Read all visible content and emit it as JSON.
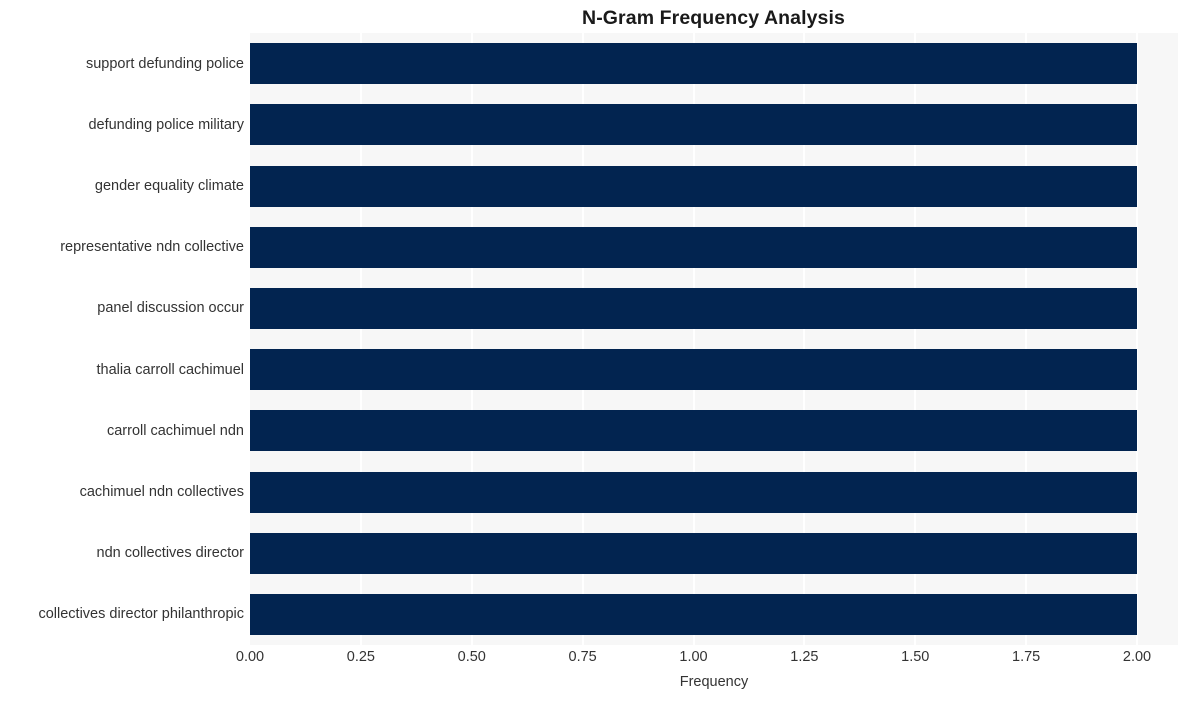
{
  "chart_data": {
    "type": "bar",
    "orientation": "horizontal",
    "title": "N-Gram Frequency Analysis",
    "xlabel": "Frequency",
    "ylabel": "",
    "categories": [
      "support defunding police",
      "defunding police military",
      "gender equality climate",
      "representative ndn collective",
      "panel discussion occur",
      "thalia carroll cachimuel",
      "carroll cachimuel ndn",
      "cachimuel ndn collectives",
      "ndn collectives director",
      "collectives director philanthropic"
    ],
    "values": [
      2,
      2,
      2,
      2,
      2,
      2,
      2,
      2,
      2,
      2
    ],
    "xlim": [
      0,
      2
    ],
    "xticks": [
      0,
      0.25,
      0.5,
      0.75,
      1.0,
      1.25,
      1.5,
      1.75,
      2.0
    ],
    "xtick_labels": [
      "0.00",
      "0.25",
      "0.50",
      "0.75",
      "1.00",
      "1.25",
      "1.50",
      "1.75",
      "2.00"
    ],
    "grid": true,
    "grid_axis": "x",
    "legend": null,
    "bar_color": "#022450",
    "plot_background": "#f7f7f7",
    "figure_background": "#ffffff",
    "gridline_color": "#ffffff",
    "text_color": "#333333",
    "title_color": "#1a1a1a"
  }
}
